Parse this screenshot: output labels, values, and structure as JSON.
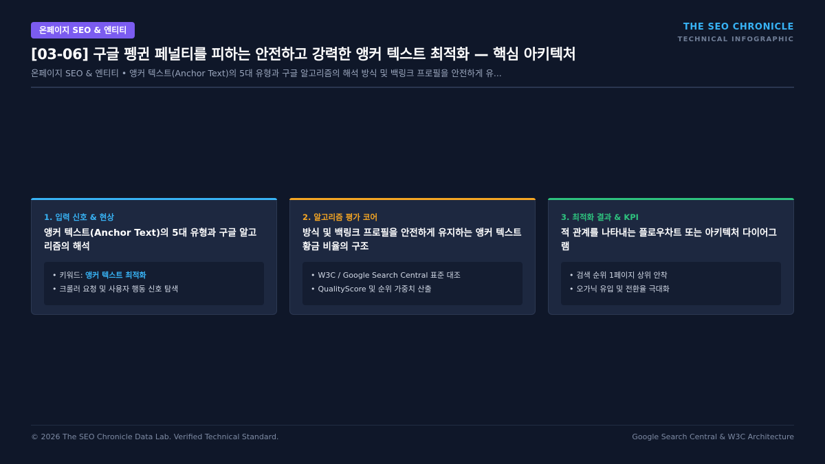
{
  "header": {
    "badge": "온페이지 SEO & 엔티티",
    "title": "[03-06] 구글 펭귄 페널티를 피하는 안전하고 강력한 앵커 텍스트 최적화 — 핵심 아키텍처",
    "subtitle": "온페이지 SEO & 엔티티 • 앵커 텍스트(Anchor Text)의 5대 유형과 구글 알고리즘의 해석 방식 및 백링크 프로필을 안전하게 유..."
  },
  "brand": {
    "name": "THE SEO CHRONICLE",
    "sub": "TECHNICAL INFOGRAPHIC"
  },
  "cards": [
    {
      "step": "1. 입력 신호 & 현상",
      "title": "앵커 텍스트(Anchor Text)의 5대 유형과 구글 알고리즘의 해석",
      "accent": "#38b3f5",
      "items": [
        {
          "prefix": "키워드: ",
          "highlight": "앵커 텍스트 최적화",
          "text": ""
        },
        {
          "prefix": "",
          "highlight": "",
          "text": "크롤러 요청 및 사용자 행동 신호 탐색"
        }
      ]
    },
    {
      "step": "2. 알고리즘 평가 코어",
      "title": "방식 및 백링크 프로필을 안전하게 유지하는 앵커 텍스트 황금 비율의 구조",
      "accent": "#f5a623",
      "items": [
        {
          "prefix": "",
          "highlight": "",
          "text": "W3C / Google Search Central 표준 대조"
        },
        {
          "prefix": "",
          "highlight": "",
          "text": "QualityScore 및 순위 가중치 산출"
        }
      ]
    },
    {
      "step": "3. 최적화 결과 & KPI",
      "title": "적 관계를 나타내는 플로우차트 또는 아키텍처 다이어그램",
      "accent": "#2ec27e",
      "items": [
        {
          "prefix": "",
          "highlight": "",
          "text": "검색 순위 1페이지 상위 안착"
        },
        {
          "prefix": "",
          "highlight": "",
          "text": "오가닉 유입 및 전환율 극대화"
        }
      ]
    }
  ],
  "footer": {
    "left": "© 2026 The SEO Chronicle Data Lab. Verified Technical Standard.",
    "right": "Google Search Central & W3C Architecture"
  }
}
